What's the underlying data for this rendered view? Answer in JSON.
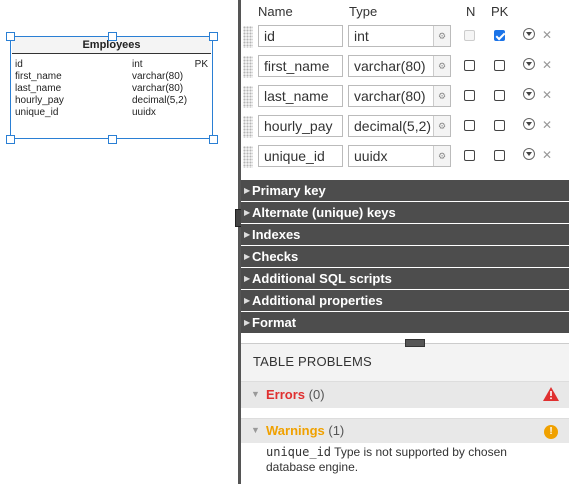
{
  "diagram": {
    "entity": {
      "title": "Employees",
      "columns": [
        {
          "name": "id",
          "type": "int",
          "key": "PK"
        },
        {
          "name": "first_name",
          "type": "varchar(80)",
          "key": ""
        },
        {
          "name": "last_name",
          "type": "varchar(80)",
          "key": ""
        },
        {
          "name": "hourly_pay",
          "type": "decimal(5,2)",
          "key": ""
        },
        {
          "name": "unique_id",
          "type": "uuidx",
          "key": ""
        }
      ]
    }
  },
  "editor": {
    "headers": {
      "name": "Name",
      "type": "Type",
      "n": "N",
      "pk": "PK"
    },
    "rows": [
      {
        "name": "id",
        "type": "int",
        "nullable": false,
        "nullable_disabled": true,
        "pk": true
      },
      {
        "name": "first_name",
        "type": "varchar(80)",
        "nullable": false,
        "nullable_disabled": false,
        "pk": false
      },
      {
        "name": "last_name",
        "type": "varchar(80)",
        "nullable": false,
        "nullable_disabled": false,
        "pk": false
      },
      {
        "name": "hourly_pay",
        "type": "decimal(5,2)",
        "nullable": false,
        "nullable_disabled": false,
        "pk": false
      },
      {
        "name": "unique_id",
        "type": "uuidx",
        "nullable": false,
        "nullable_disabled": false,
        "pk": false
      }
    ],
    "sections": [
      "Primary key",
      "Alternate (unique) keys",
      "Indexes",
      "Checks",
      "Additional SQL scripts",
      "Additional properties",
      "Format"
    ],
    "delete_glyph": "✕"
  },
  "problems": {
    "title": "TABLE PROBLEMS",
    "errors": {
      "label": "Errors",
      "count": "(0)"
    },
    "warnings": {
      "label": "Warnings",
      "count": "(1)",
      "icon": "!"
    },
    "warning_message": {
      "code": "unique_id",
      "text": "Type is not supported by chosen database engine."
    }
  },
  "colors": {
    "accent": "#1a73e8",
    "section_bg": "#4d4d4d",
    "error": "#e03030",
    "warning": "#f0a100",
    "selection": "#2a7fd4"
  }
}
